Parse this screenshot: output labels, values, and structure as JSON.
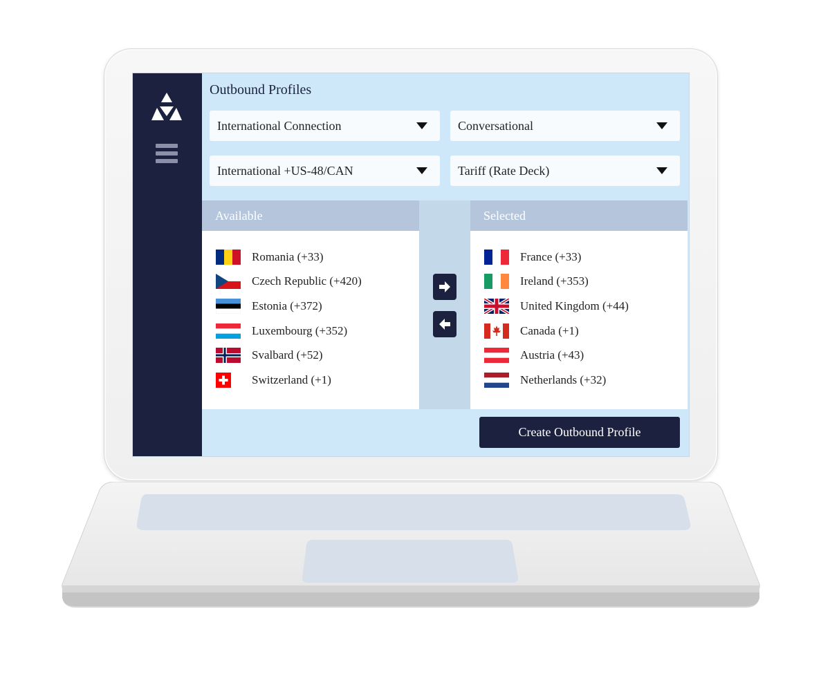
{
  "page": {
    "title": "Outbound Profiles"
  },
  "selects": {
    "connection": {
      "value": "International Connection"
    },
    "type": {
      "value": "Conversational"
    },
    "region": {
      "value": "International +US-48/CAN"
    },
    "tariff": {
      "value": "Tariff (Rate Deck)"
    }
  },
  "available": {
    "header": "Available",
    "items": [
      {
        "label": "Romania (+33)",
        "flag": "romania-flag"
      },
      {
        "label": "Czech Republic (+420)",
        "flag": "czech-flag"
      },
      {
        "label": "Estonia (+372)",
        "flag": "estonia-flag"
      },
      {
        "label": "Luxembourg (+352)",
        "flag": "luxembourg-flag"
      },
      {
        "label": "Svalbard (+52)",
        "flag": "norway-flag"
      },
      {
        "label": "Switzerland (+1)",
        "flag": "switzerland-flag"
      }
    ]
  },
  "selected": {
    "header": "Selected",
    "items": [
      {
        "label": "France (+33)",
        "flag": "france-flag"
      },
      {
        "label": "Ireland (+353)",
        "flag": "ireland-flag"
      },
      {
        "label": "United Kingdom (+44)",
        "flag": "uk-flag"
      },
      {
        "label": "Canada (+1)",
        "flag": "canada-flag"
      },
      {
        "label": "Austria (+43)",
        "flag": "austria-flag"
      },
      {
        "label": "Netherlands (+32)",
        "flag": "netherlands-flag"
      }
    ]
  },
  "actions": {
    "create_label": "Create Outbound Profile"
  },
  "colors": {
    "sidebar": "#1c2140",
    "screen_bg": "#cfe8f9",
    "panel_header": "#b5c6dc",
    "middle_strip": "#c3d9ea",
    "button": "#1c2140"
  }
}
